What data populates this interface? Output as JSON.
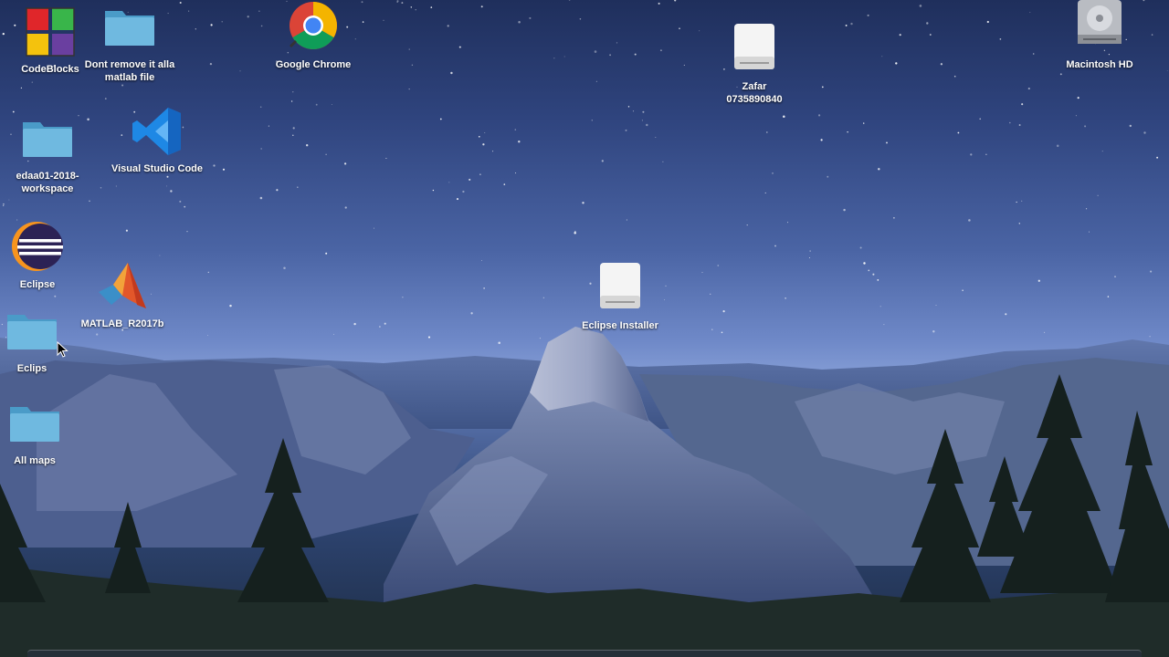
{
  "desktop": {
    "icons": [
      {
        "id": "codeblocks",
        "label": "CodeBlocks",
        "icon": "codeblocks-icon"
      },
      {
        "id": "dont-remove",
        "label": "Dont remove it alla\nmatlab file",
        "icon": "folder-icon"
      },
      {
        "id": "chrome",
        "label": "Google Chrome",
        "icon": "chrome-icon"
      },
      {
        "id": "zafar",
        "label": "Zafar\n0735890840",
        "icon": "drive-icon"
      },
      {
        "id": "macintosh-hd",
        "label": "Macintosh HD",
        "icon": "hard-disk-icon"
      },
      {
        "id": "edaa01",
        "label": "edaa01-2018-\nworkspace",
        "icon": "folder-icon"
      },
      {
        "id": "vscode",
        "label": "Visual Studio Code",
        "icon": "vscode-icon"
      },
      {
        "id": "eclipse",
        "label": "Eclipse",
        "icon": "eclipse-icon"
      },
      {
        "id": "matlab",
        "label": "MATLAB_R2017b",
        "icon": "matlab-icon"
      },
      {
        "id": "eclipse-installer",
        "label": "Eclipse Installer",
        "icon": "drive-icon"
      },
      {
        "id": "eclips",
        "label": "Eclips",
        "icon": "folder-icon"
      },
      {
        "id": "all-maps",
        "label": "All maps",
        "icon": "folder-icon"
      }
    ]
  },
  "colors": {
    "folder": "#6fb9e0",
    "folder_dark": "#4a9bc8",
    "label": "#ffffff",
    "sky_top": "#1f2f5c",
    "sky_horizon": "#7f98d2"
  }
}
